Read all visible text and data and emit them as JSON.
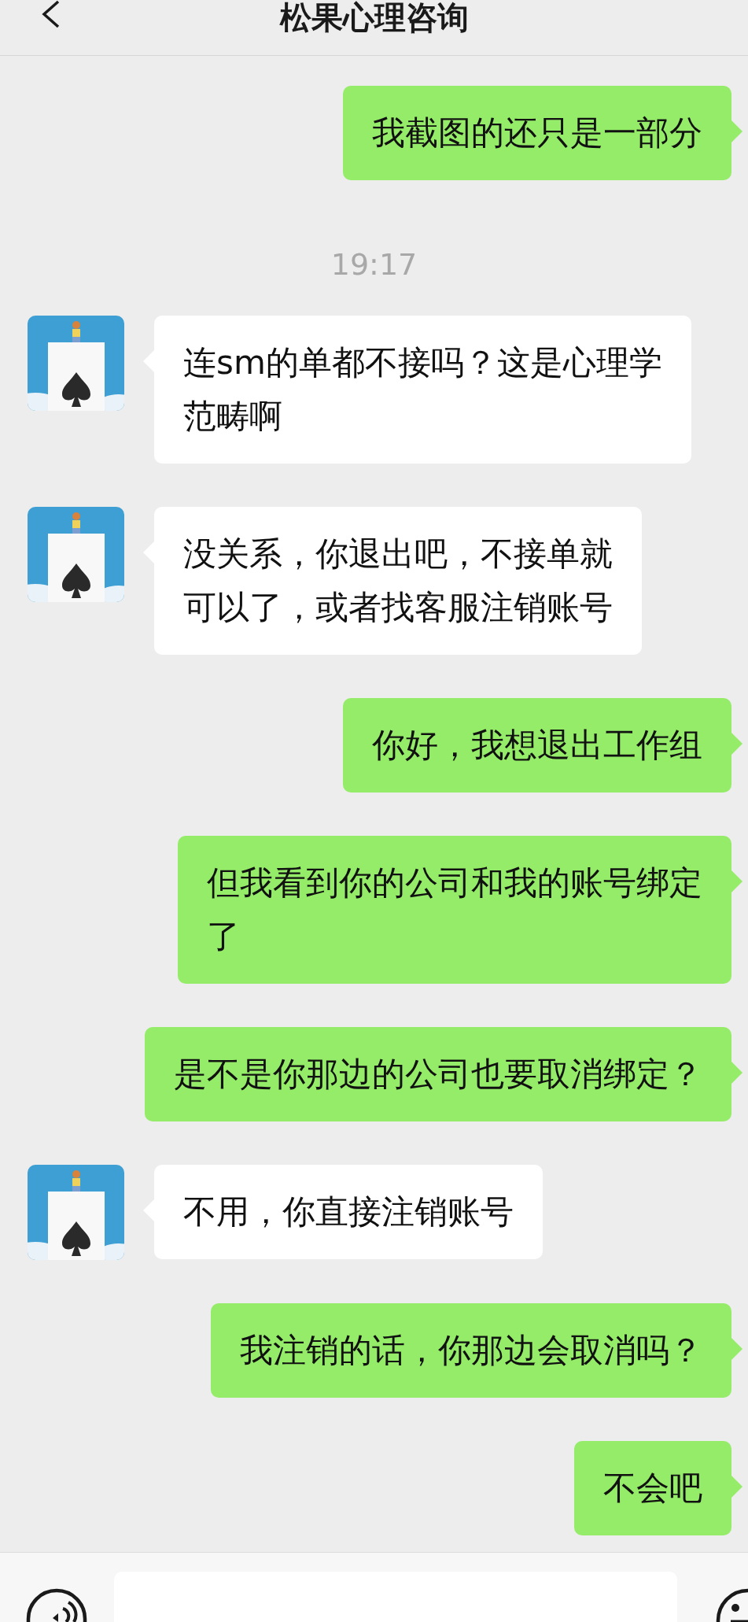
{
  "header": {
    "title": "松果心理咨询"
  },
  "messages": [
    {
      "kind": "sent",
      "lines": [
        "我截图的还只是一部分"
      ]
    },
    {
      "kind": "time",
      "text": "19:17"
    },
    {
      "kind": "received",
      "lines": [
        "连sm的单都不接吗？这是心理学",
        "范畴啊"
      ]
    },
    {
      "kind": "received",
      "lines": [
        "没关系，你退出吧，不接单就",
        "可以了，或者找客服注销账号"
      ]
    },
    {
      "kind": "sent",
      "lines": [
        "你好，我想退出工作组"
      ]
    },
    {
      "kind": "sent",
      "lines": [
        "但我看到你的公司和我的账号绑定",
        "了"
      ]
    },
    {
      "kind": "sent",
      "lines": [
        "是不是你那边的公司也要取消绑定？"
      ]
    },
    {
      "kind": "received",
      "lines": [
        "不用，你直接注销账号"
      ]
    },
    {
      "kind": "sent",
      "lines": [
        "我注销的话，你那边会取消吗？"
      ]
    },
    {
      "kind": "sent",
      "lines": [
        "不会吧"
      ]
    }
  ]
}
